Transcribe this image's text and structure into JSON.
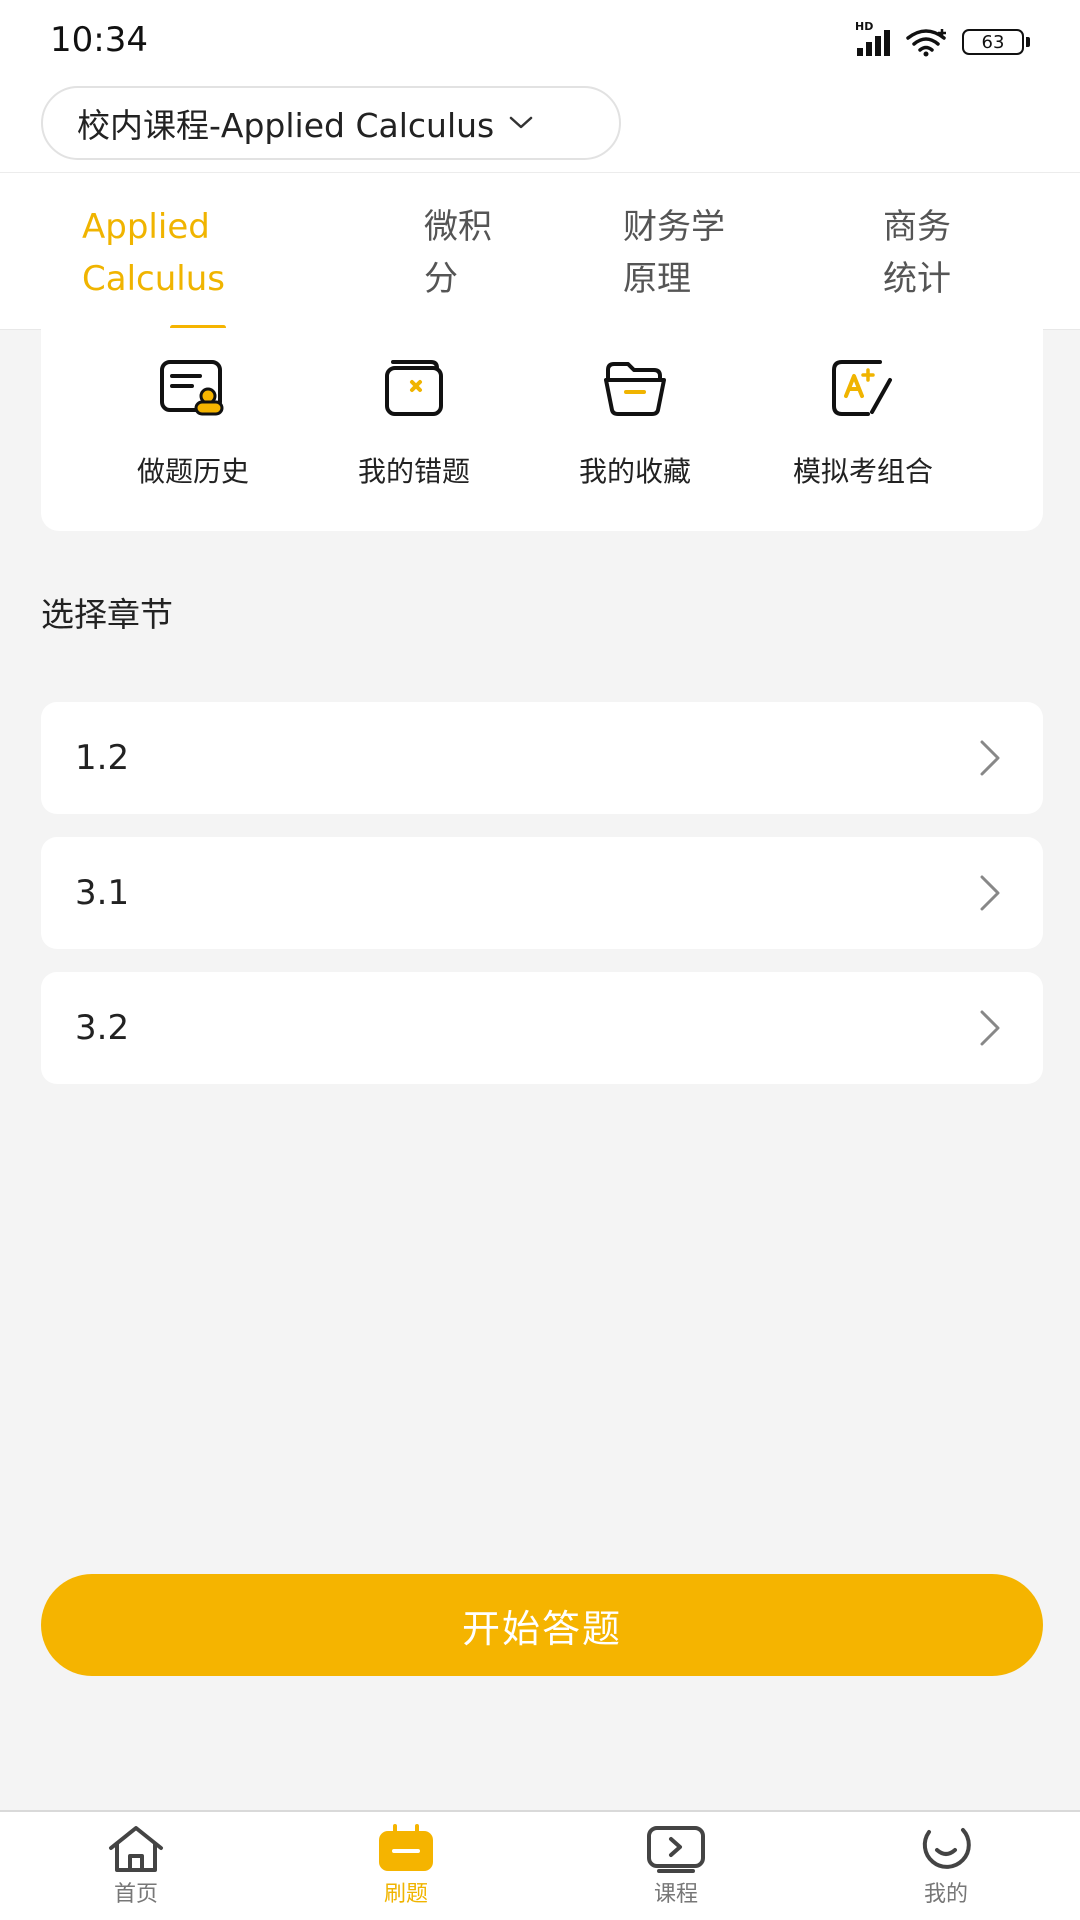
{
  "status_bar": {
    "time": "10:34",
    "network": "HD",
    "battery": "63"
  },
  "course_selector": {
    "label": "校内课程-Applied Calculus"
  },
  "tabs": [
    {
      "line1": "Applied",
      "line2": "Calculus",
      "active": true
    },
    {
      "line1": "微积",
      "line2": "分",
      "active": false
    },
    {
      "line1": "财务学",
      "line2": "原理",
      "active": false
    },
    {
      "line1": "商务",
      "line2": "统计",
      "active": false
    }
  ],
  "quick_actions": [
    {
      "label": "做题历史",
      "icon": "history-icon"
    },
    {
      "label": "我的错题",
      "icon": "wrong-questions-icon"
    },
    {
      "label": "我的收藏",
      "icon": "favorites-folder-icon"
    },
    {
      "label": "模拟考组合",
      "icon": "mock-exam-icon"
    }
  ],
  "section_title": "选择章节",
  "chapters": [
    {
      "label": "1.2"
    },
    {
      "label": "3.1"
    },
    {
      "label": "3.2"
    }
  ],
  "start_button": {
    "label": "开始答题"
  },
  "bottom_nav": [
    {
      "label": "首页",
      "icon": "home-icon",
      "active": false
    },
    {
      "label": "刷题",
      "icon": "practice-icon",
      "active": true
    },
    {
      "label": "课程",
      "icon": "course-play-icon",
      "active": false
    },
    {
      "label": "我的",
      "icon": "profile-icon",
      "active": false
    }
  ],
  "colors": {
    "accent": "#f5b400",
    "background": "#f4f4f4",
    "card": "#ffffff"
  }
}
